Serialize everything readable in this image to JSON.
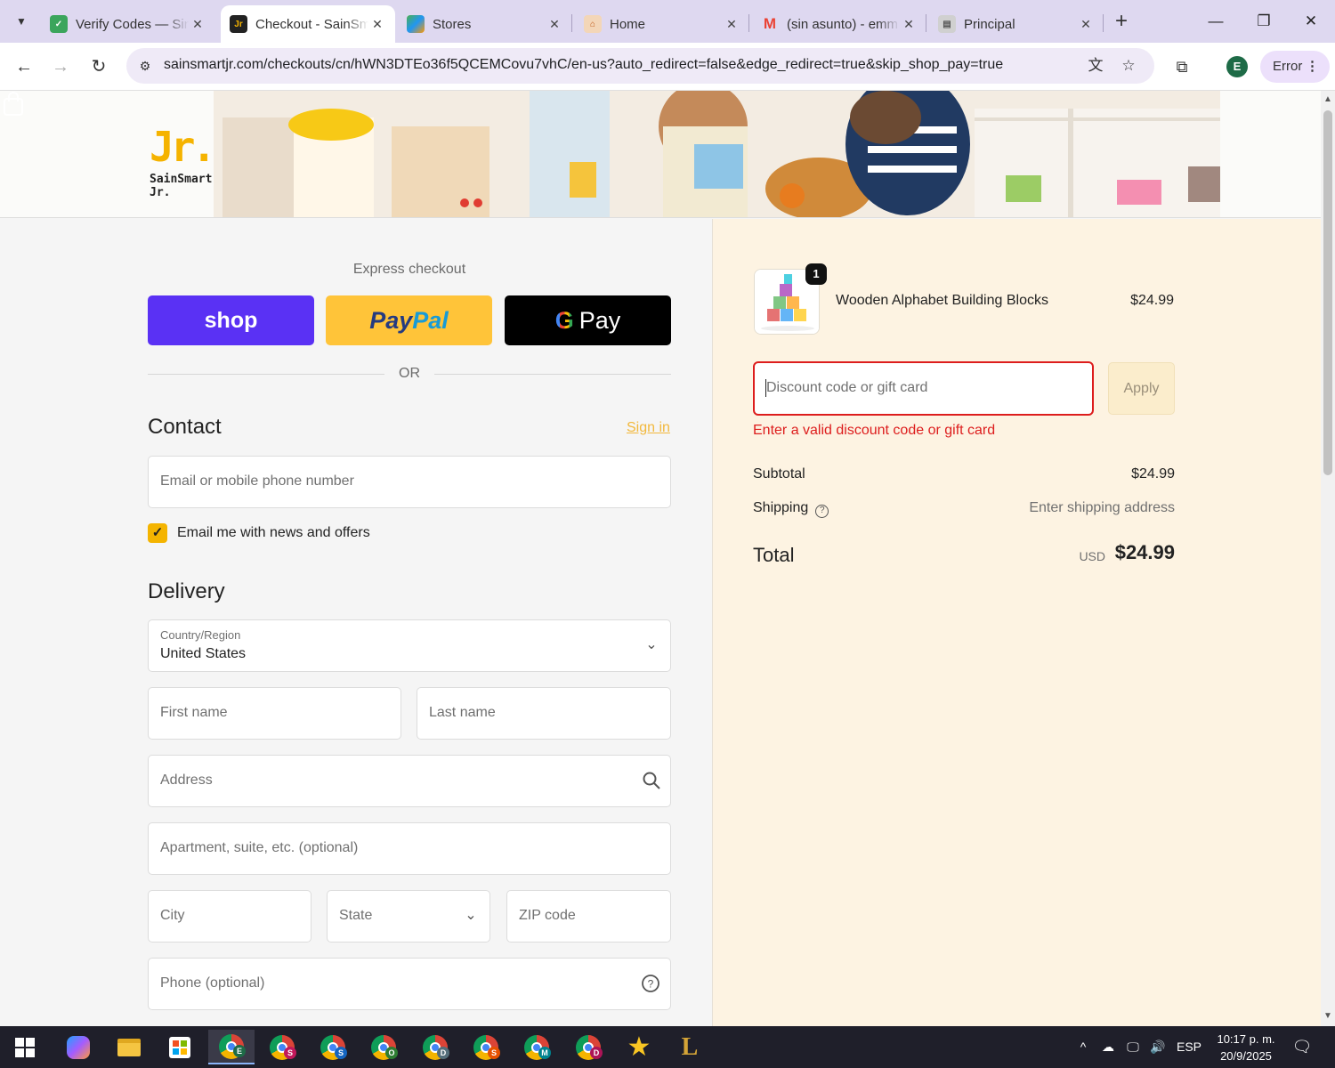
{
  "browser": {
    "tabs": [
      {
        "title": "Verify Codes — Sin",
        "favicon": "verify-favicon",
        "color": "#3ba55c"
      },
      {
        "title": "Checkout - SainSm",
        "favicon": "sainsmart-favicon",
        "color": "#222222"
      },
      {
        "title": "Stores",
        "favicon": "stores-favicon",
        "color": "#e88a3a"
      },
      {
        "title": "Home",
        "favicon": "home-favicon",
        "color": "#e07a3a"
      },
      {
        "title": "(sin asunto) - emm",
        "favicon": "gmail-icon",
        "color": "#ea4335"
      },
      {
        "title": "Principal",
        "favicon": "principal-favicon",
        "color": "#888888"
      }
    ],
    "url": "sainsmartjr.com/checkouts/cn/hWN3DTEo36f5QCEMCovu7vhC/en-us?auto_redirect=false&edge_redirect=true&skip_shop_pay=true",
    "profile_initial": "E",
    "error_chip": "Error"
  },
  "header": {
    "logo_mark": "Jr.",
    "logo_text": "SainSmart Jr."
  },
  "express": {
    "title": "Express checkout",
    "shop_label": "shop",
    "paypal_part1": "Pay",
    "paypal_part2": "Pal",
    "gpay_g": "G",
    "gpay_label": "Pay",
    "or": "OR"
  },
  "contact": {
    "title": "Contact",
    "sign_in": "Sign in",
    "email_placeholder": "Email or mobile phone number",
    "newsletter_label": "Email me with news and offers",
    "newsletter_checked": true
  },
  "delivery": {
    "title": "Delivery",
    "country_label": "Country/Region",
    "country_value": "United States",
    "first_name": "First name",
    "last_name": "Last name",
    "address": "Address",
    "apartment": "Apartment, suite, etc. (optional)",
    "city": "City",
    "state": "State",
    "zip": "ZIP code",
    "phone": "Phone (optional)"
  },
  "summary": {
    "item_quantity": "1",
    "item_name": "Wooden Alphabet Building Blocks",
    "item_price": "$24.99",
    "discount_placeholder": "Discount code or gift card",
    "apply_label": "Apply",
    "discount_error": "Enter a valid discount code or gift card",
    "subtotal_label": "Subtotal",
    "subtotal_value": "$24.99",
    "shipping_label": "Shipping",
    "shipping_value": "Enter shipping address",
    "total_label": "Total",
    "total_currency": "USD",
    "total_value": "$24.99",
    "error_color": "#dd1d1d",
    "accent_color": "#f4b400"
  },
  "taskbar": {
    "language": "ESP",
    "time": "10:17 p. m.",
    "date": "20/9/2025"
  }
}
